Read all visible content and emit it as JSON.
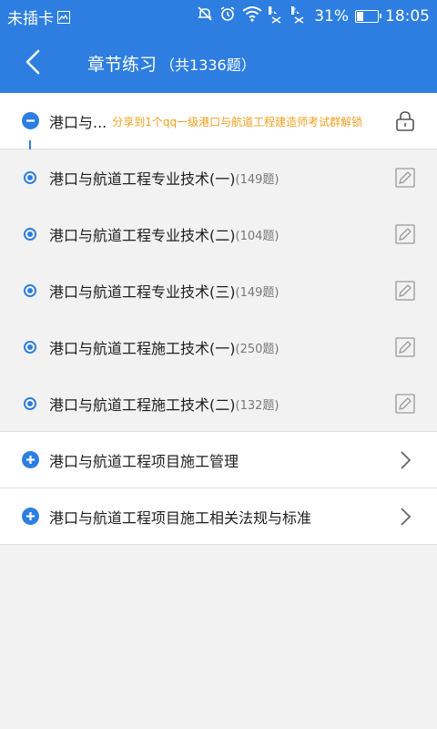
{
  "status_bar": {
    "carrier": "未插卡",
    "battery_percent": "31%",
    "battery_level": 0.31,
    "time": "18:05",
    "sim1_tag": "1",
    "sim2_tag": "2"
  },
  "header": {
    "title": "章节练习",
    "count": "（共1336题）"
  },
  "chapters": [
    {
      "title": "港口与...",
      "share_text": "分享到1个qq一级港口与航道工程建造师考试群解锁",
      "expanded": true,
      "locked": true,
      "sections": [
        {
          "title": "港口与航道工程专业技术(一)",
          "count": "(149题)"
        },
        {
          "title": "港口与航道工程专业技术(二)",
          "count": "(104题)"
        },
        {
          "title": "港口与航道工程专业技术(三)",
          "count": "(149题)"
        },
        {
          "title": "港口与航道工程施工技术(一)",
          "count": "(250题)"
        },
        {
          "title": "港口与航道工程施工技术(二)",
          "count": "(132题)"
        }
      ]
    },
    {
      "title": "港口与航道工程项目施工管理",
      "expanded": false
    },
    {
      "title": "港口与航道工程项目施工相关法规与标准",
      "expanded": false
    }
  ],
  "icons": {
    "expanded": "minus-icon",
    "collapsed": "plus-icon",
    "lock": "lock-icon",
    "edit": "edit-icon",
    "chevron": "chevron-right-icon",
    "back": "back-arrow-icon"
  },
  "colors": {
    "primary": "#2d7ee0",
    "share_text": "#f0a020",
    "background": "#f2f2f2"
  }
}
